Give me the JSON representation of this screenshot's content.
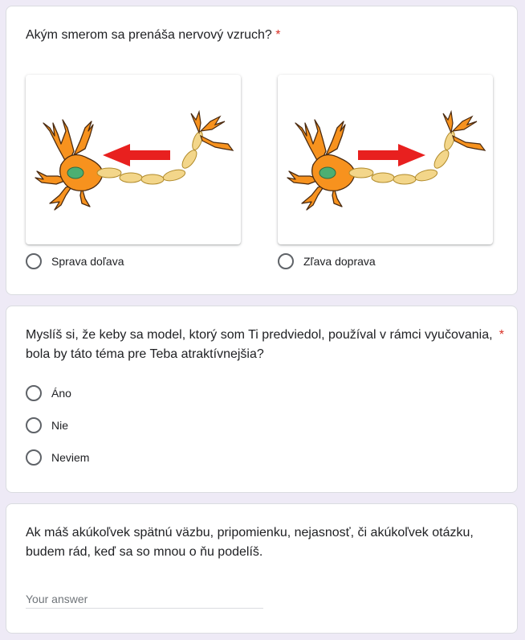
{
  "q1": {
    "title": "Akým smerom sa prenáša nervový vzruch?",
    "required_mark": "*",
    "options": [
      {
        "label": "Sprava doľava",
        "arrow": "left"
      },
      {
        "label": "Zľava doprava",
        "arrow": "right"
      }
    ]
  },
  "q2": {
    "title_line1": "Myslíš si, že keby sa model, ktorý som Ti predviedol, používal v rámci vyučovania,",
    "title_line2": "bola by táto téma pre Teba atraktívnejšia?",
    "required_mark": "*",
    "options": [
      "Áno",
      "Nie",
      "Neviem"
    ]
  },
  "q3": {
    "title_line1": "Ak máš akúkoľvek spätnú väzbu, pripomienku, nejasnosť, či akúkoľvek otázku,",
    "title_line2": "budem rád, keď sa so mnou o ňu podelíš.",
    "placeholder": "Your answer",
    "value": ""
  },
  "colors": {
    "background": "#eeeaf6",
    "required": "#d93025",
    "neuron": "#f7921e",
    "axon": "#f3d68a",
    "nucleus": "#4caf72",
    "arrow": "#e8201f"
  }
}
